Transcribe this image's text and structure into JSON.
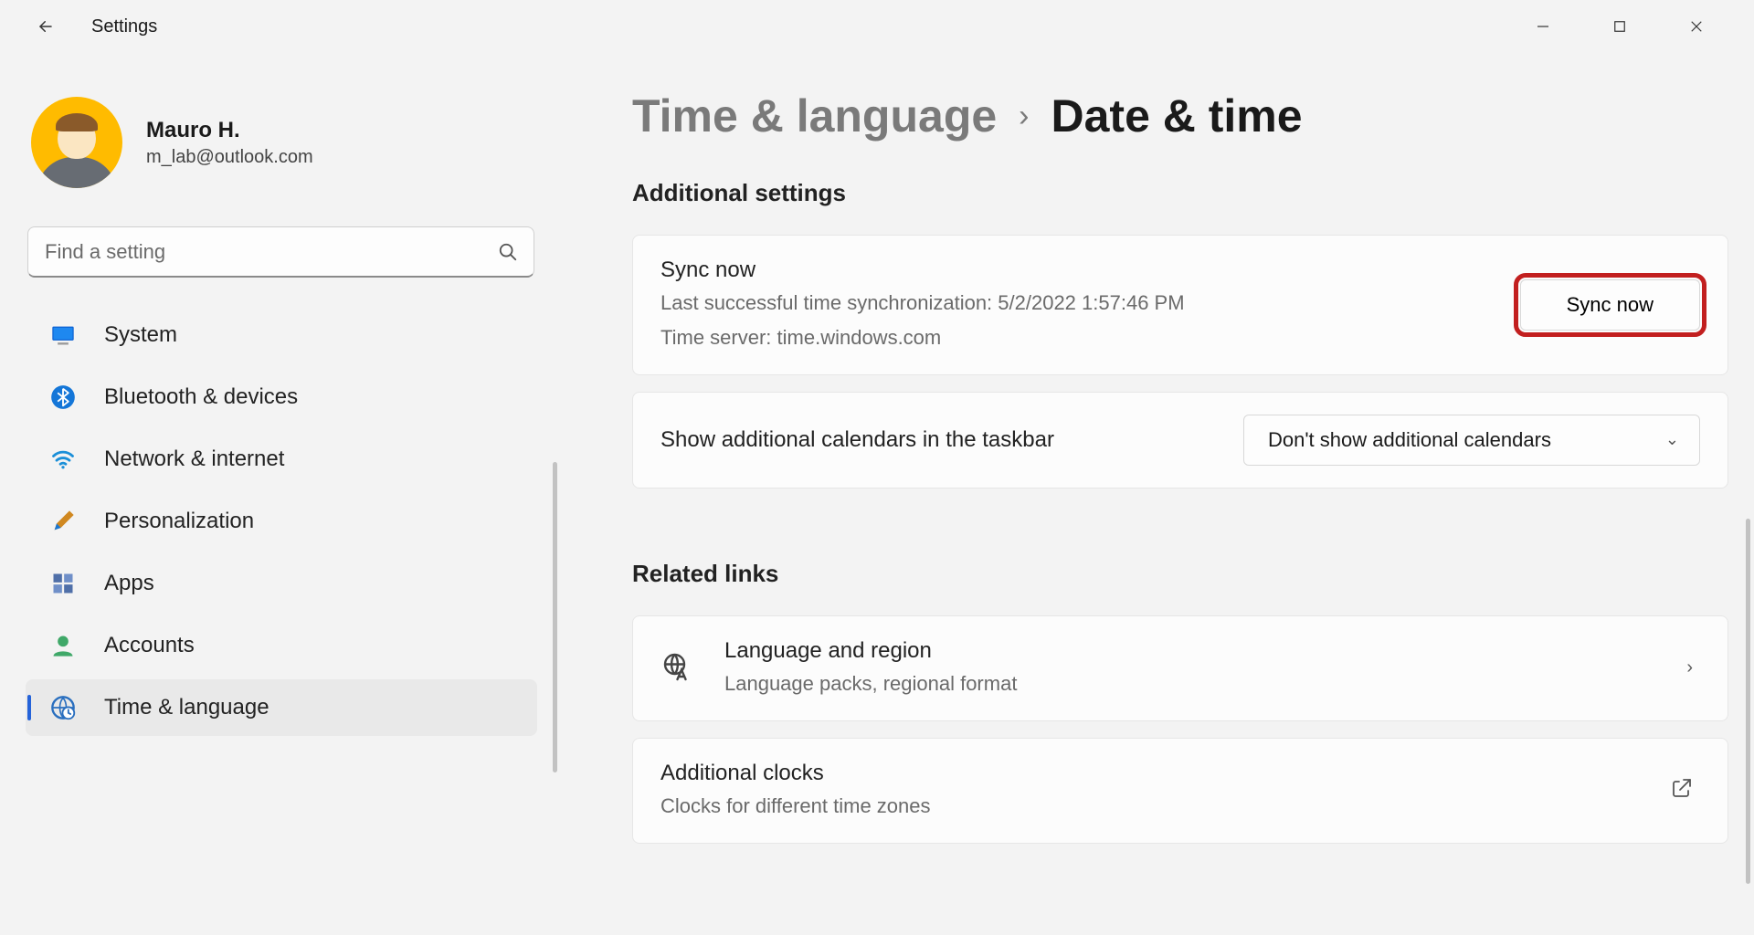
{
  "app": {
    "title": "Settings"
  },
  "profile": {
    "name": "Mauro H.",
    "email": "m_lab@outlook.com"
  },
  "search": {
    "placeholder": "Find a setting"
  },
  "sidebar": {
    "items": [
      {
        "label": "System"
      },
      {
        "label": "Bluetooth & devices"
      },
      {
        "label": "Network & internet"
      },
      {
        "label": "Personalization"
      },
      {
        "label": "Apps"
      },
      {
        "label": "Accounts"
      },
      {
        "label": "Time & language"
      }
    ]
  },
  "breadcrumb": {
    "parent": "Time & language",
    "current": "Date & time"
  },
  "sections": {
    "additional": "Additional settings",
    "related": "Related links"
  },
  "sync": {
    "title": "Sync now",
    "last": "Last successful time synchronization: 5/2/2022 1:57:46 PM",
    "server": "Time server: time.windows.com",
    "button": "Sync now"
  },
  "calendars": {
    "label": "Show additional calendars in the taskbar",
    "value": "Don't show additional calendars"
  },
  "related": {
    "language": {
      "title": "Language and region",
      "sub": "Language packs, regional format"
    },
    "clocks": {
      "title": "Additional clocks",
      "sub": "Clocks for different time zones"
    }
  }
}
